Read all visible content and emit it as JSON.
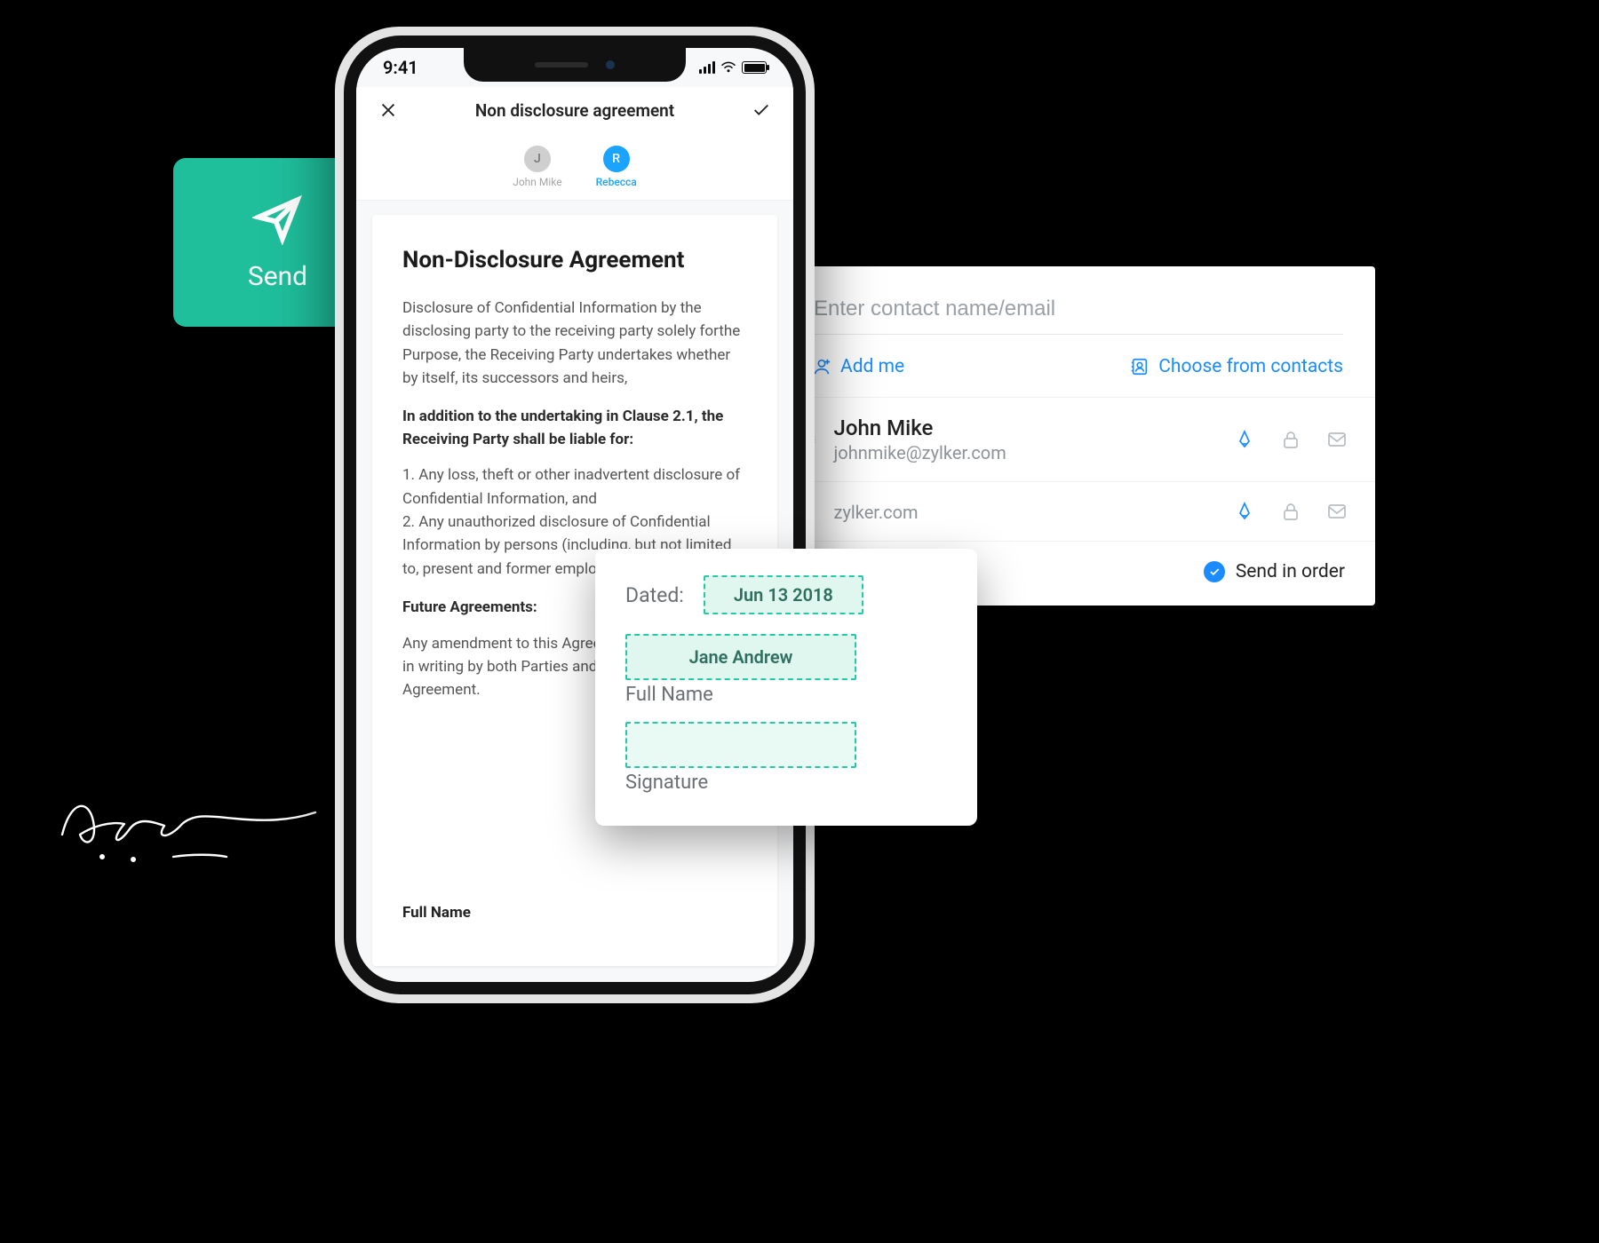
{
  "send_card": {
    "label": "Send"
  },
  "phone": {
    "status_time": "9:41",
    "nav_title": "Non disclosure agreement",
    "signers": [
      {
        "initial": "J",
        "name": "John Mike",
        "active": false
      },
      {
        "initial": "R",
        "name": "Rebecca",
        "active": true
      }
    ],
    "document": {
      "title": "Non-Disclosure Agreement",
      "intro": "Disclosure of Confidential Information by the disclosing party to the receiving party solely forthe Purpose, the Receiving Party undertakes whether by itself, its successors and heirs,",
      "clause_bold": "In addition to the undertaking in Clause 2.1, the Receiving Party shall be liable for:",
      "clause_items": "1. Any loss, theft or other inadvertent disclosure of Confidential Information, and\n2. Any unauthorized disclosure of Confidential Information by persons (including, but not limited to, present and former employees)",
      "future_heading": "Future Agreements:",
      "future_text": "Any amendment to this Agreement must be agreed in writing by both Parties and shall refer to this Agreement.",
      "foot_label": "Full Name"
    }
  },
  "fields_card": {
    "dated_label": "Dated:",
    "dated_value": "Jun 13 2018",
    "name_value": "Jane Andrew",
    "full_name_caption": "Full Name",
    "signature_caption": "Signature"
  },
  "contact_panel": {
    "search_placeholder": "Enter contact name/email",
    "add_me": "Add me",
    "choose_contacts": "Choose from contacts",
    "rows": [
      {
        "name": "John Mike",
        "email": "johnmike@zylker.com"
      },
      {
        "name": "",
        "email": "zylker.com"
      }
    ],
    "send_in_order": "Send in order"
  }
}
